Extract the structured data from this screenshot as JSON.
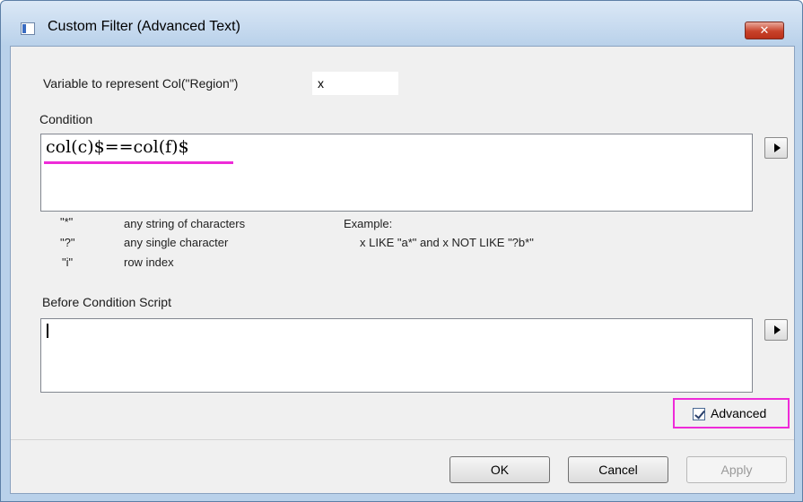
{
  "window": {
    "title": "Custom Filter (Advanced Text)",
    "close_glyph": "✕"
  },
  "variable": {
    "label": "Variable to represent Col(\"Region\")",
    "value": "x"
  },
  "condition": {
    "label": "Condition",
    "value": "col(c)$==col(f)$"
  },
  "help": {
    "rows": [
      {
        "symbol": "\"*\"",
        "desc": "any string of characters"
      },
      {
        "symbol": "\"?\"",
        "desc": "any single character"
      },
      {
        "symbol": "\"i\"",
        "desc": "row index"
      }
    ],
    "example_label": "Example:",
    "example_text": "x LIKE \"a*\" and x NOT LIKE \"?b*\""
  },
  "before_script": {
    "label": "Before Condition Script",
    "value": ""
  },
  "advanced": {
    "label": "Advanced",
    "checked": true
  },
  "buttons": {
    "ok": "OK",
    "cancel": "Cancel",
    "apply": "Apply"
  },
  "colors": {
    "highlight": "#ee2bd8",
    "title_bar": "#b9d1ea",
    "close_button": "#c8422a"
  }
}
